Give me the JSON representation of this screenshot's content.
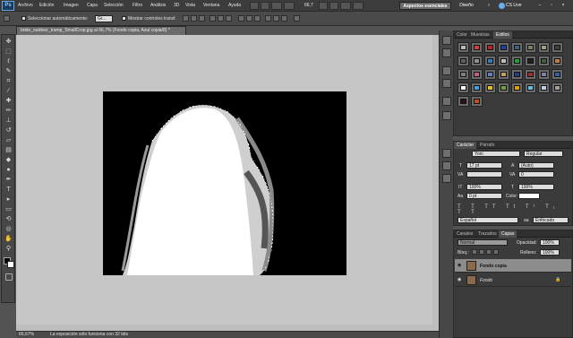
{
  "app": {
    "logo": "Ps"
  },
  "menu": [
    "Archivo",
    "Edición",
    "Imagen",
    "Capa",
    "Selección",
    "Filtro",
    "Análisis",
    "3D",
    "Vista",
    "Ventana",
    "Ayuda"
  ],
  "zoom_menu": "66,7",
  "workspace": {
    "essentials": "Aspectos esenciales",
    "design": "Diseño",
    "cslive": "CS Live"
  },
  "options": {
    "auto_select_label": "Seleccionar automáticamente:",
    "auto_select_value": "Gr...",
    "show_transform_label": "Mostrar controles transf."
  },
  "document": {
    "tab_title": "bride_outdoor_tramp_SmallCrop.jpg al 66,7% (Fondo copia, Azul copia/8) *"
  },
  "status": {
    "zoom": "66,67%",
    "message": "La exposición sólo funciona con 32 bits"
  },
  "panels": {
    "color_tabs": [
      "Color",
      "Muestras",
      "Estilos"
    ],
    "char_tabs": [
      "Carácter",
      "Párrafo"
    ],
    "layer_tabs": [
      "Canales",
      "Trazados",
      "Capas"
    ]
  },
  "character": {
    "font": "Yoni",
    "style": "Regular",
    "size": "17 pt",
    "leading": "(Auto)",
    "tracking_label": "VA",
    "kerning": "0",
    "vscale": "100%",
    "hscale": "100%",
    "baseline": "0 pt",
    "color_label": "Color:",
    "language": "Español",
    "antialias": "Enfocado"
  },
  "layers": {
    "blend": "Normal",
    "opacity_label": "Opacidad:",
    "opacity": "100%",
    "lock_label": "Bloq.:",
    "fill_label": "Relleno:",
    "fill": "100%",
    "items": [
      {
        "name": "Fondo copia",
        "selected": true
      },
      {
        "name": "Fondo",
        "selected": false
      }
    ]
  },
  "colors": {
    "accent": "#1b3b5e",
    "workspace_btn": "#555555",
    "canvas": "#000000",
    "doc_bg": "#c6c6c6"
  }
}
